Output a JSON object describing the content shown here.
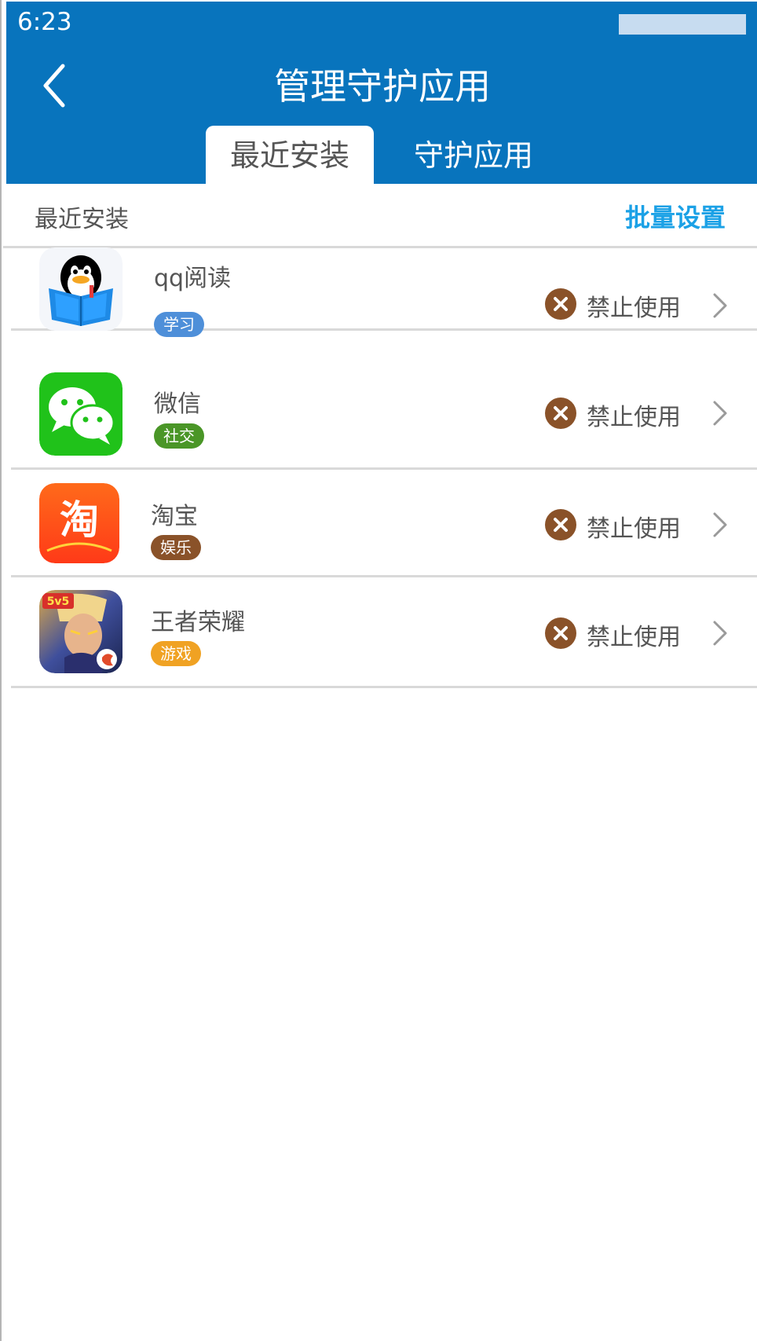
{
  "status_bar": {
    "time": "6:23"
  },
  "header": {
    "title": "管理守护应用"
  },
  "tabs": [
    {
      "label": "最近安装"
    },
    {
      "label": "守护应用"
    }
  ],
  "section": {
    "title": "最近安装",
    "batch_label": "批量设置"
  },
  "apps": [
    {
      "name": "qq阅读",
      "tag": "学习",
      "tag_color": "#4e8fd9",
      "status": "禁止使用",
      "icon": "qq-reading-icon"
    },
    {
      "name": "微信",
      "tag": "社交",
      "tag_color": "#4a9627",
      "status": "禁止使用",
      "icon": "wechat-icon"
    },
    {
      "name": "淘宝",
      "tag": "娱乐",
      "tag_color": "#8a5229",
      "status": "禁止使用",
      "icon": "taobao-icon"
    },
    {
      "name": "王者荣耀",
      "tag": "游戏",
      "tag_color": "#f0a223",
      "status": "禁止使用",
      "icon": "honor-of-kings-icon"
    }
  ],
  "colors": {
    "header_bg": "#0874bd",
    "accent_link": "#1ba1e6",
    "block_icon": "#8a5229"
  }
}
